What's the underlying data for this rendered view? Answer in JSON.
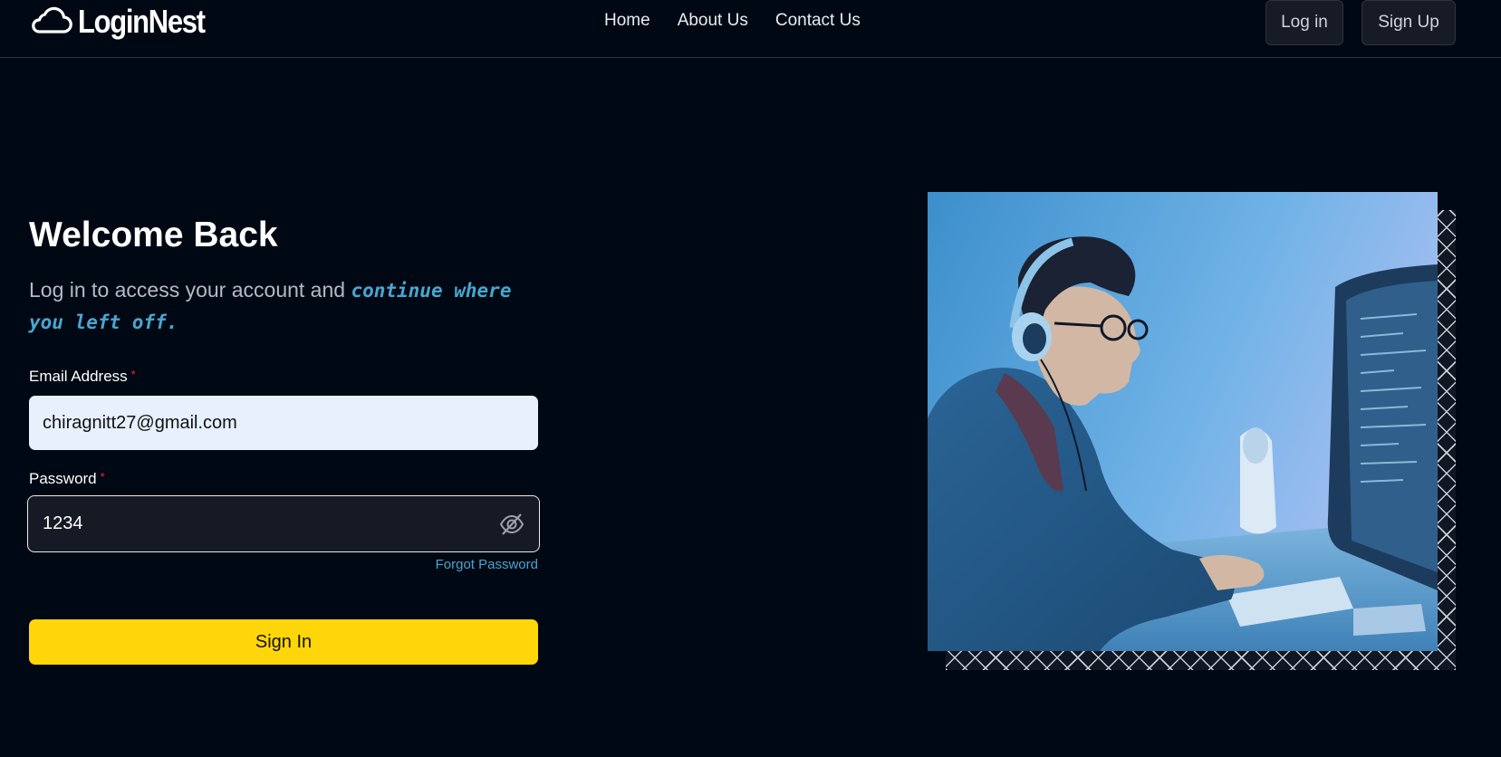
{
  "brand": {
    "name": "LoginNest",
    "icon": "cloud-icon"
  },
  "nav": {
    "links": [
      "Home",
      "About Us",
      "Contact Us"
    ]
  },
  "auth": {
    "login_label": "Log in",
    "signup_label": "Sign Up"
  },
  "form": {
    "title": "Welcome Back",
    "subtitle_plain": "Log in to access your account and ",
    "subtitle_accent": "continue where you left off.",
    "email_label": "Email Address",
    "email_required_mark": "*",
    "email_value": "chiragnitt27@gmail.com",
    "password_label": "Password",
    "password_required_mark": "*",
    "password_value": "1234",
    "password_toggle_icon": "eye-slash-icon",
    "forgot_label": "Forgot Password",
    "submit_label": "Sign In"
  },
  "colors": {
    "background": "#000814",
    "accent_text": "#49a6cf",
    "primary_button": "#ffd60a",
    "required": "#e03131"
  },
  "hero": {
    "image": "person-with-headphones-coding-at-computer"
  }
}
